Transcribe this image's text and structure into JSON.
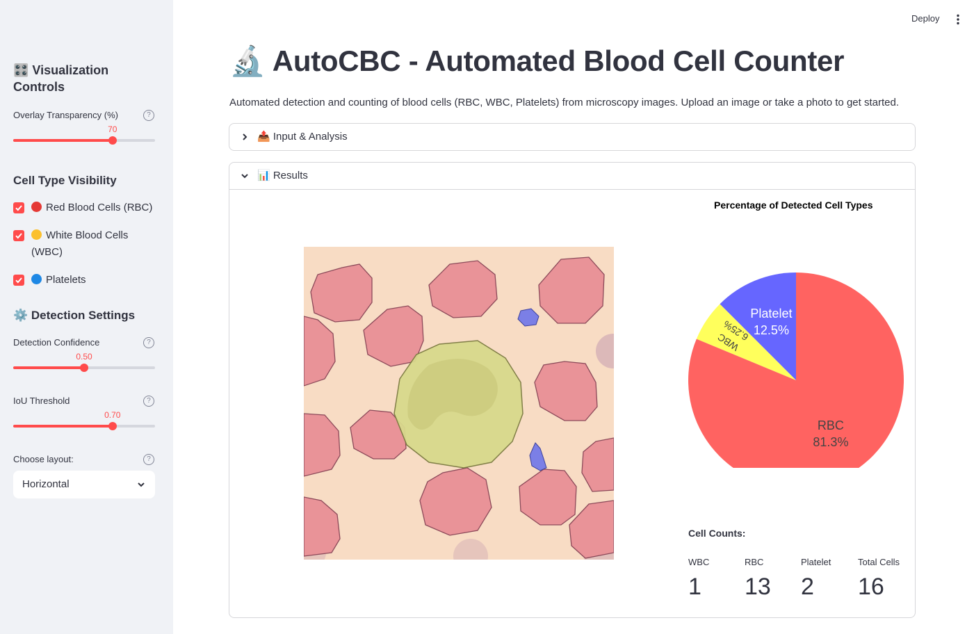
{
  "sidebar": {
    "viz_heading": "🎛️ Visualization Controls",
    "overlay": {
      "label": "Overlay Transparency (%)",
      "value": 70,
      "value_text": "70",
      "min": 0,
      "max": 100
    },
    "cell_type_heading": "Cell Type Visibility",
    "cell_types": [
      {
        "label": "Red Blood Cells (RBC)",
        "checked": true,
        "dot_color": "#e53935"
      },
      {
        "label": "White Blood Cells (WBC)",
        "checked": true,
        "dot_color": "#fbc02d"
      },
      {
        "label": "Platelets",
        "checked": true,
        "dot_color": "#1e88e5"
      }
    ],
    "detection_heading": "⚙️ Detection Settings",
    "confidence": {
      "label": "Detection Confidence",
      "value": 0.5,
      "value_text": "0.50",
      "min": 0,
      "max": 1
    },
    "iou": {
      "label": "IoU Threshold",
      "value": 0.7,
      "value_text": "0.70",
      "min": 0,
      "max": 1
    },
    "layout": {
      "label": "Choose layout:",
      "selected": "Horizontal"
    }
  },
  "header": {
    "deploy_label": "Deploy",
    "menu_icon": "kebab-icon"
  },
  "main": {
    "title": "🔬 AutoCBC - Automated Blood Cell Counter",
    "subtitle": "Automated detection and counting of blood cells (RBC, WBC, Platelets) from microscopy images. Upload an image or take a photo to get started.",
    "input_expander": {
      "label": "📤 Input & Analysis",
      "expanded": false
    },
    "results_expander": {
      "label": "📊 Results",
      "expanded": true
    }
  },
  "chart_data": {
    "type": "pie",
    "title": "Percentage of Detected Cell Types",
    "slices": [
      {
        "label": "RBC",
        "value": 81.3,
        "pct_text": "81.3%",
        "color": "#ff6361"
      },
      {
        "label": "WBC",
        "value": 6.25,
        "pct_text": "6.25%",
        "color": "#ffff5c"
      },
      {
        "label": "Platelet",
        "value": 12.5,
        "pct_text": "12.5%",
        "color": "#6666ff"
      }
    ]
  },
  "counts": {
    "heading": "Cell Counts:",
    "metrics": [
      {
        "label": "WBC",
        "value": "1"
      },
      {
        "label": "RBC",
        "value": "13"
      },
      {
        "label": "Platelet",
        "value": "2"
      },
      {
        "label": "Total Cells",
        "value": "16"
      }
    ]
  }
}
